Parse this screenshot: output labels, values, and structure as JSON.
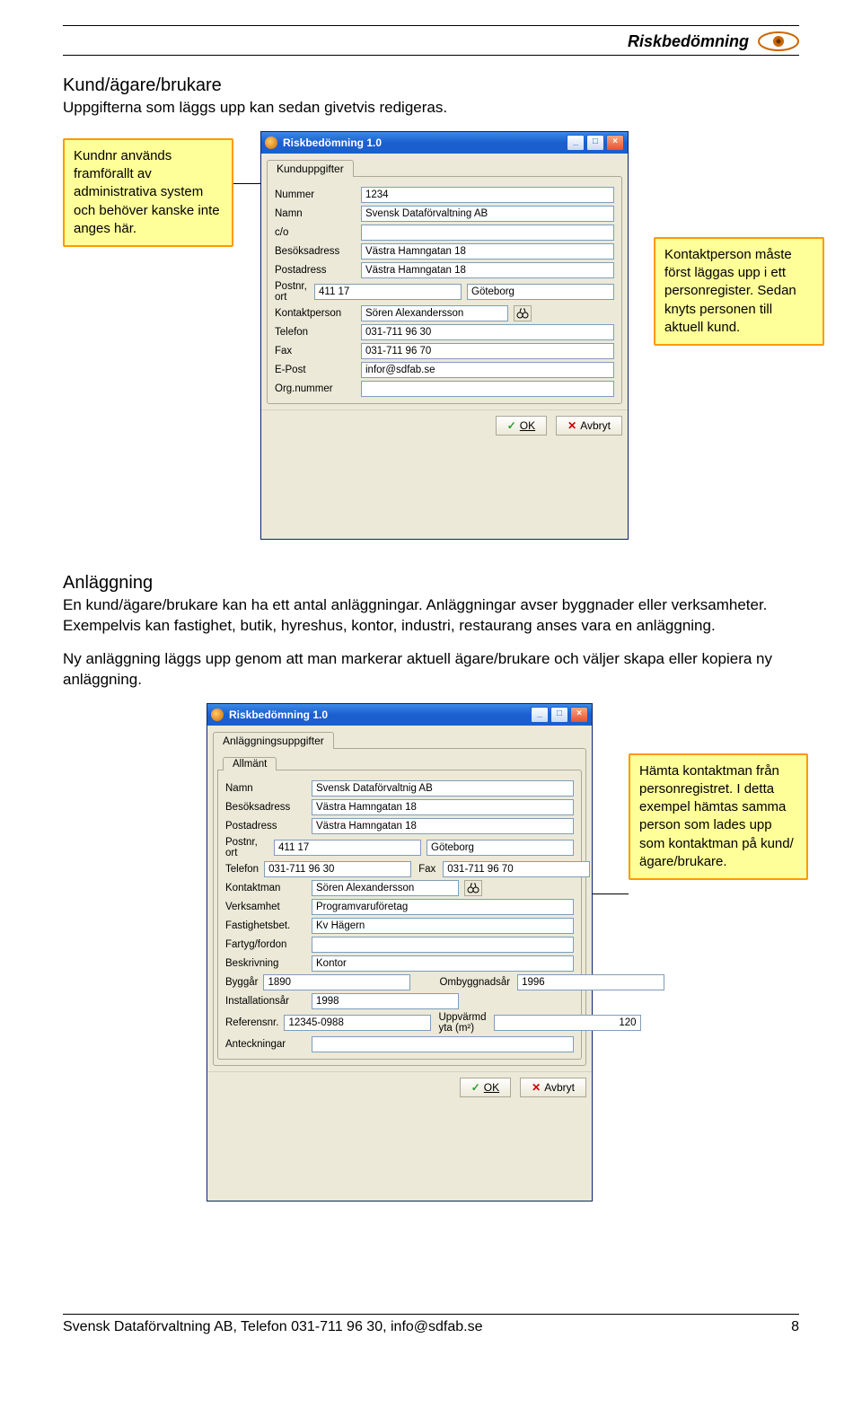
{
  "header": {
    "title": "Riskbedömning"
  },
  "section1": {
    "title": "Kund/ägare/brukare",
    "intro": "Uppgifterna som läggs upp kan sedan givetvis redigeras."
  },
  "callout1": "Kundnr används framförallt av administrativa system och behöver kanske inte anges här.",
  "callout2": "Kontaktperson måste först läggas upp i ett personregister. Sedan knyts personen till aktuell kund.",
  "win1": {
    "title": "Riskbedömning 1.0",
    "tab": "Kunduppgifter",
    "labels": {
      "nummer": "Nummer",
      "namn": "Namn",
      "co": "c/o",
      "besok": "Besöksadress",
      "post": "Postadress",
      "postnr": "Postnr, ort",
      "kontakt": "Kontaktperson",
      "telefon": "Telefon",
      "fax": "Fax",
      "epost": "E-Post",
      "orgnr": "Org.nummer"
    },
    "values": {
      "nummer": "1234",
      "namn": "Svensk Dataförvaltning AB",
      "co": "",
      "besok": "Västra Hamngatan 18",
      "post": "Västra Hamngatan 18",
      "postnr": "411 17",
      "ort": "Göteborg",
      "kontakt": "Sören Alexandersson",
      "telefon": "031-711 96 30",
      "fax": "031-711 96 70",
      "epost": "infor@sdfab.se",
      "orgnr": ""
    },
    "buttons": {
      "ok": "OK",
      "cancel": "Avbryt"
    }
  },
  "section2": {
    "title": "Anläggning",
    "p1": "En kund/ägare/brukare kan ha ett antal anläggningar. Anläggningar avser byggnader eller verksamheter. Exempelvis kan fastighet, butik, hyreshus, kontor, industri, restaurang anses vara en anläggning.",
    "p2": "Ny anläggning läggs upp genom att man markerar aktuell ägare/brukare och väljer skapa eller kopiera ny  anläggning."
  },
  "callout3": "Hämta kontaktman från personregistret. I detta exempel hämtas samma person som lades upp som kontaktman på kund/ägare/brukare.",
  "win2": {
    "title": "Riskbedömning 1.0",
    "tab": "Anläggningsuppgifter",
    "subtab": "Allmänt",
    "labels": {
      "namn": "Namn",
      "besok": "Besöksadress",
      "post": "Postadress",
      "postnr": "Postnr, ort",
      "telefon": "Telefon",
      "fax": "Fax",
      "kontakt": "Kontaktman",
      "verks": "Verksamhet",
      "fastb": "Fastighetsbet.",
      "fartyg": "Fartyg/fordon",
      "beskr": "Beskrivning",
      "byggar": "Byggår",
      "ombyggnad": "Ombyggnadsår",
      "install": "Installationsår",
      "refnr": "Referensnr.",
      "uppvarmd": "Uppvärmd yta (m²)",
      "anteck": "Anteckningar"
    },
    "values": {
      "namn": "Svensk Dataförvaltnig AB",
      "besok": "Västra Hamngatan 18",
      "post": "Västra Hamngatan 18",
      "postnr": "411 17",
      "ort": "Göteborg",
      "telefon": "031-711 96 30",
      "faxnr": "031-711 96 70",
      "kontakt": "Sören Alexandersson",
      "verks": "Programvaruföretag",
      "fastb": "Kv Hägern",
      "fartyg": "",
      "beskr": "Kontor",
      "byggar": "1890",
      "ombyggnad": "1996",
      "install": "1998",
      "refnr": "12345-0988",
      "uppvarmd": "120",
      "anteck": ""
    },
    "buttons": {
      "ok": "OK",
      "cancel": "Avbryt"
    }
  },
  "footer": {
    "text": "Svensk Dataförvaltning AB, Telefon 031-711 96 30, info@sdfab.se",
    "page": "8"
  },
  "icons": {
    "binoculars": "binoculars-icon"
  }
}
